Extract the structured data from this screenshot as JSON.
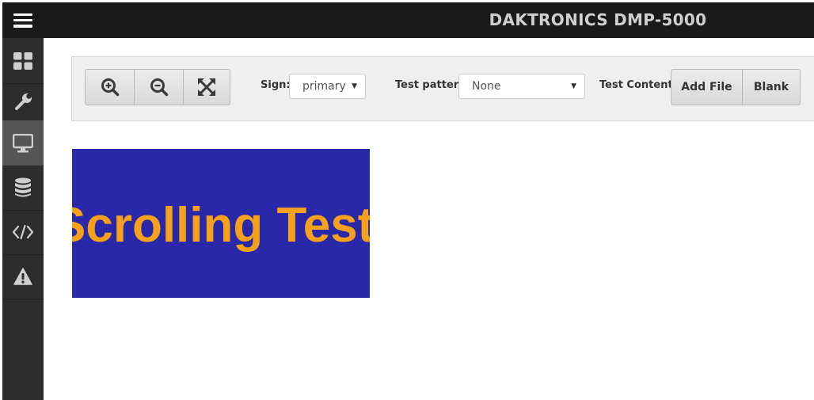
{
  "header": {
    "title": "DAKTRONICS DMP-5000",
    "menu_icon": "hamburger-menu-icon"
  },
  "sidebar": {
    "items": [
      {
        "id": "dashboard",
        "icon": "dashboard-grid-icon",
        "active": false
      },
      {
        "id": "settings",
        "icon": "wrench-icon",
        "active": false
      },
      {
        "id": "display",
        "icon": "monitor-icon",
        "active": true
      },
      {
        "id": "database",
        "icon": "database-icon",
        "active": false
      },
      {
        "id": "code",
        "icon": "code-icon",
        "active": false
      },
      {
        "id": "warnings",
        "icon": "warning-icon",
        "active": false
      }
    ]
  },
  "toolbar": {
    "zoom_buttons": [
      {
        "id": "zoom-in",
        "icon": "zoom-in-icon"
      },
      {
        "id": "zoom-out",
        "icon": "zoom-out-icon"
      },
      {
        "id": "fit",
        "icon": "expand-icon"
      }
    ],
    "sign_label": "Sign:",
    "sign_value": "primary",
    "test_pattern_label": "Test pattern",
    "test_pattern_value": "None",
    "test_content_label": "Test Content",
    "add_file_label": "Add File",
    "blank_label": "Blank"
  },
  "preview": {
    "text": "Scrolling Test",
    "background_color": "#2828a8",
    "text_color": "#f5a11c"
  },
  "colors": {
    "topbar": "#1a1a1a",
    "sidebar": "#2d2d2d",
    "sidebar_active": "#555555",
    "toolbar_bg": "#efefef"
  }
}
